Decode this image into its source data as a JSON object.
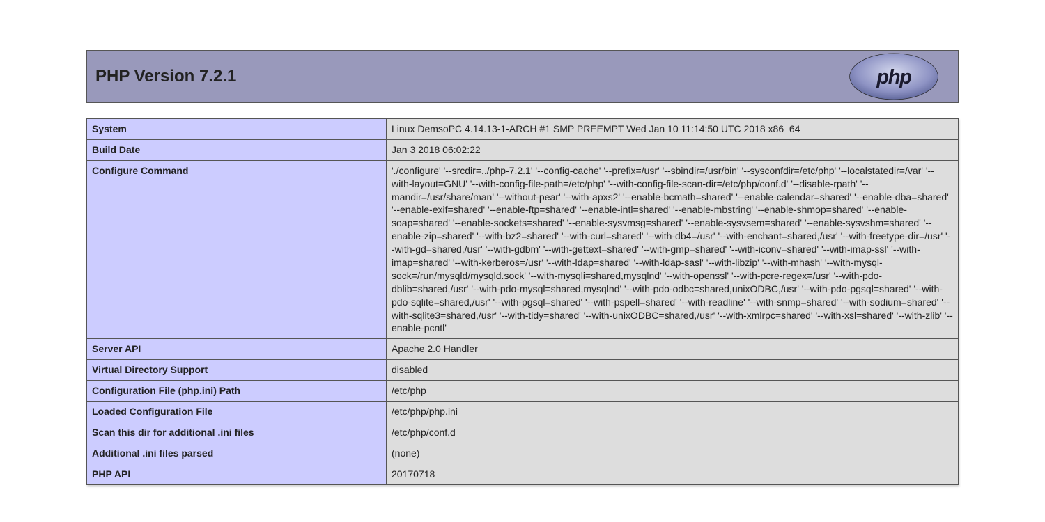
{
  "header": {
    "title": "PHP Version 7.2.1"
  },
  "rows": [
    {
      "label": "System",
      "value": "Linux DemsoPC 4.14.13-1-ARCH #1 SMP PREEMPT Wed Jan 10 11:14:50 UTC 2018 x86_64"
    },
    {
      "label": "Build Date",
      "value": "Jan 3 2018 06:02:22"
    },
    {
      "label": "Configure Command",
      "value": "'./configure' '--srcdir=../php-7.2.1' '--config-cache' '--prefix=/usr' '--sbindir=/usr/bin' '--sysconfdir=/etc/php' '--localstatedir=/var' '--with-layout=GNU' '--with-config-file-path=/etc/php' '--with-config-file-scan-dir=/etc/php/conf.d' '--disable-rpath' '--mandir=/usr/share/man' '--without-pear' '--with-apxs2' '--enable-bcmath=shared' '--enable-calendar=shared' '--enable-dba=shared' '--enable-exif=shared' '--enable-ftp=shared' '--enable-intl=shared' '--enable-mbstring' '--enable-shmop=shared' '--enable-soap=shared' '--enable-sockets=shared' '--enable-sysvmsg=shared' '--enable-sysvsem=shared' '--enable-sysvshm=shared' '--enable-zip=shared' '--with-bz2=shared' '--with-curl=shared' '--with-db4=/usr' '--with-enchant=shared,/usr' '--with-freetype-dir=/usr' '--with-gd=shared,/usr' '--with-gdbm' '--with-gettext=shared' '--with-gmp=shared' '--with-iconv=shared' '--with-imap-ssl' '--with-imap=shared' '--with-kerberos=/usr' '--with-ldap=shared' '--with-ldap-sasl' '--with-libzip' '--with-mhash' '--with-mysql-sock=/run/mysqld/mysqld.sock' '--with-mysqli=shared,mysqlnd' '--with-openssl' '--with-pcre-regex=/usr' '--with-pdo-dblib=shared,/usr' '--with-pdo-mysql=shared,mysqlnd' '--with-pdo-odbc=shared,unixODBC,/usr' '--with-pdo-pgsql=shared' '--with-pdo-sqlite=shared,/usr' '--with-pgsql=shared' '--with-pspell=shared' '--with-readline' '--with-snmp=shared' '--with-sodium=shared' '--with-sqlite3=shared,/usr' '--with-tidy=shared' '--with-unixODBC=shared,/usr' '--with-xmlrpc=shared' '--with-xsl=shared' '--with-zlib' '--enable-pcntl'"
    },
    {
      "label": "Server API",
      "value": "Apache 2.0 Handler"
    },
    {
      "label": "Virtual Directory Support",
      "value": "disabled"
    },
    {
      "label": "Configuration File (php.ini) Path",
      "value": "/etc/php"
    },
    {
      "label": "Loaded Configuration File",
      "value": "/etc/php/php.ini"
    },
    {
      "label": "Scan this dir for additional .ini files",
      "value": "/etc/php/conf.d"
    },
    {
      "label": "Additional .ini files parsed",
      "value": "(none)"
    },
    {
      "label": "PHP API",
      "value": "20170718"
    }
  ]
}
